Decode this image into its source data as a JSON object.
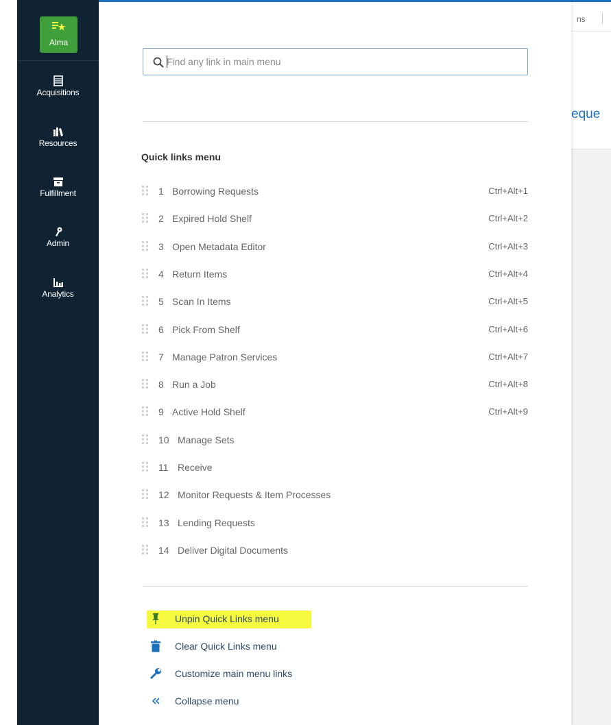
{
  "left_nav": {
    "logo_label": "Alma",
    "items": [
      {
        "label": "Acquisitions",
        "icon": "acquisitions-icon"
      },
      {
        "label": "Resources",
        "icon": "resources-icon"
      },
      {
        "label": "Fulfillment",
        "icon": "fulfillment-icon"
      },
      {
        "label": "Admin",
        "icon": "admin-icon"
      },
      {
        "label": "Analytics",
        "icon": "analytics-icon"
      }
    ]
  },
  "background": {
    "header_fragment": "ns",
    "title_fragment": "eque"
  },
  "search": {
    "placeholder": "Find any link in main menu",
    "value": ""
  },
  "quick_links": {
    "title": "Quick links menu",
    "items": [
      {
        "num": "1",
        "label": "Borrowing Requests",
        "shortcut": "Ctrl+Alt+1"
      },
      {
        "num": "2",
        "label": "Expired Hold Shelf",
        "shortcut": "Ctrl+Alt+2"
      },
      {
        "num": "3",
        "label": "Open Metadata Editor",
        "shortcut": "Ctrl+Alt+3"
      },
      {
        "num": "4",
        "label": "Return Items",
        "shortcut": "Ctrl+Alt+4"
      },
      {
        "num": "5",
        "label": "Scan In Items",
        "shortcut": "Ctrl+Alt+5"
      },
      {
        "num": "6",
        "label": "Pick From Shelf",
        "shortcut": "Ctrl+Alt+6"
      },
      {
        "num": "7",
        "label": "Manage Patron Services",
        "shortcut": "Ctrl+Alt+7"
      },
      {
        "num": "8",
        "label": "Run a Job",
        "shortcut": "Ctrl+Alt+8"
      },
      {
        "num": "9",
        "label": "Active Hold Shelf",
        "shortcut": "Ctrl+Alt+9"
      },
      {
        "num": "10",
        "label": "Manage Sets",
        "shortcut": ""
      },
      {
        "num": "11",
        "label": "Receive",
        "shortcut": ""
      },
      {
        "num": "12",
        "label": "Monitor Requests & Item Processes",
        "shortcut": ""
      },
      {
        "num": "13",
        "label": "Lending Requests",
        "shortcut": ""
      },
      {
        "num": "14",
        "label": "Deliver Digital Documents",
        "shortcut": ""
      }
    ]
  },
  "actions": [
    {
      "label": "Unpin Quick Links menu",
      "icon": "pin-icon",
      "highlighted": true
    },
    {
      "label": "Clear Quick Links menu",
      "icon": "trash-icon",
      "highlighted": false
    },
    {
      "label": "Customize main menu links",
      "icon": "wrench-icon",
      "highlighted": false
    },
    {
      "label": "Collapse menu",
      "icon": "double-chevron-left-icon",
      "highlighted": false
    }
  ],
  "colors": {
    "nav_bg": "#0f2333",
    "logo_green": "#3fa03b",
    "link_blue": "#1d72c0",
    "highlight_yellow": "#f7f93f"
  }
}
